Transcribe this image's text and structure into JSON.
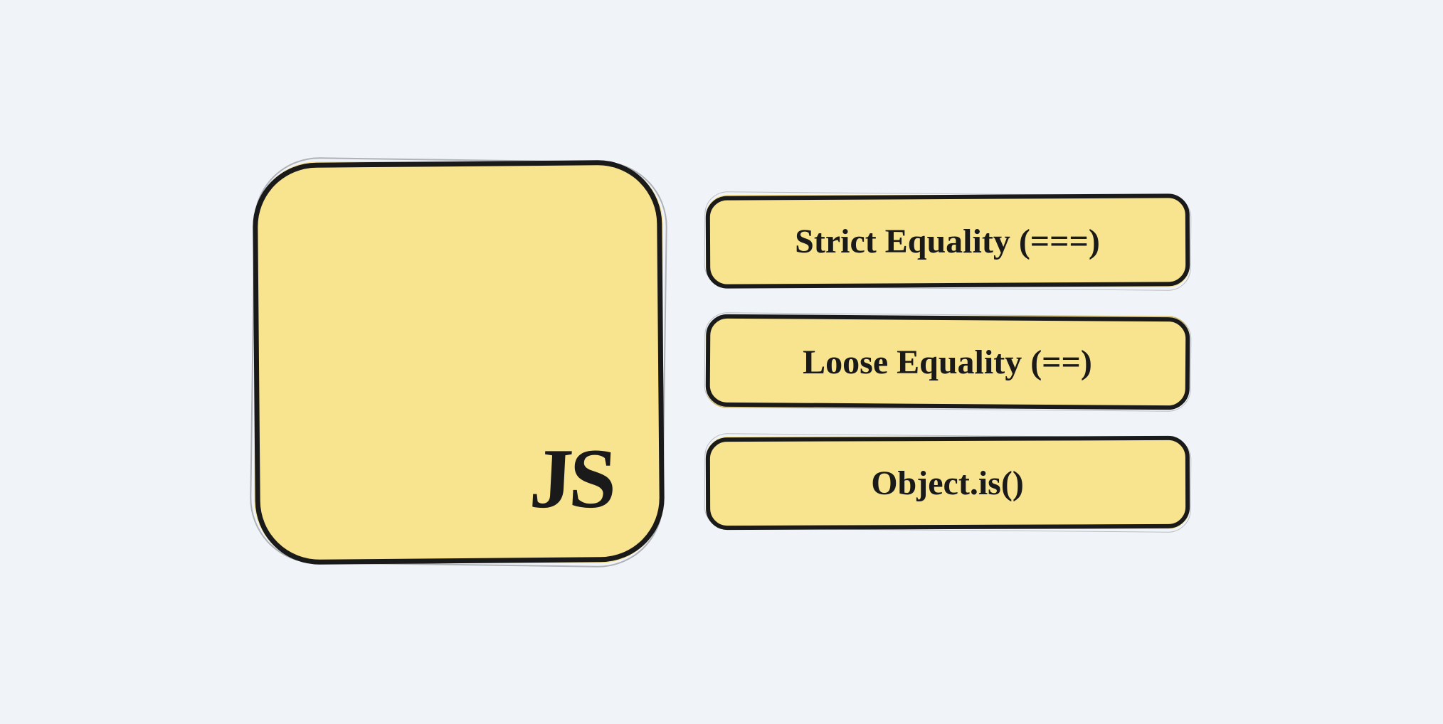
{
  "logo": {
    "label": "JS"
  },
  "cards": [
    {
      "label": "Strict Equality (===)"
    },
    {
      "label": "Loose Equality (==)"
    },
    {
      "label": "Object.is()"
    }
  ],
  "colors": {
    "background": "#f0f4f9",
    "box_fill": "#f8e38e",
    "stroke": "#1a1a1a"
  }
}
